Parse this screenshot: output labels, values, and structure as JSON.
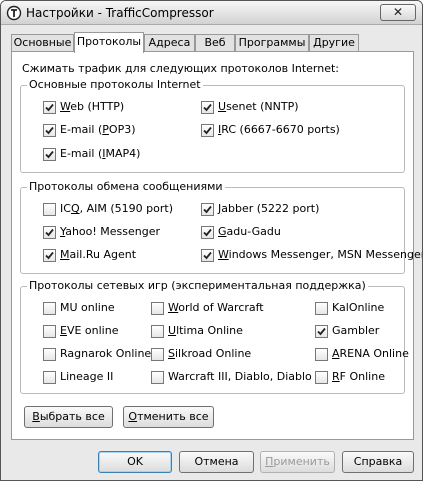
{
  "window": {
    "title": "Настройки - TrafficCompressor",
    "close_glyph": "✕"
  },
  "tabs": [
    {
      "label": "Основные",
      "active": false
    },
    {
      "label": "Протоколы",
      "active": true
    },
    {
      "label": "Адреса",
      "active": false
    },
    {
      "label": "Веб",
      "active": false
    },
    {
      "label": "Программы",
      "active": false
    },
    {
      "label": "Другие",
      "active": false
    }
  ],
  "intro": "Сжимать трафик для следующих протоколов Internet:",
  "groups": {
    "internet": {
      "title": "Основные протоколы Internet",
      "items": [
        {
          "pre": "",
          "u": "W",
          "post": "eb (HTTP)",
          "checked": true
        },
        {
          "pre": "",
          "u": "U",
          "post": "senet (NNTP)",
          "checked": true
        },
        {
          "pre": "E-mail (",
          "u": "P",
          "post": "OP3)",
          "checked": true
        },
        {
          "pre": "",
          "u": "I",
          "post": "RC (6667-6670 ports)",
          "checked": true
        },
        {
          "pre": "E-mail (",
          "u": "I",
          "post": "MAP4)",
          "checked": true
        }
      ]
    },
    "messaging": {
      "title": "Протоколы обмена сообщениями",
      "items": [
        {
          "pre": "IC",
          "u": "Q",
          "post": ", AIM (5190 port)",
          "checked": false
        },
        {
          "pre": "",
          "u": "J",
          "post": "abber (5222 port)",
          "checked": true
        },
        {
          "pre": "",
          "u": "Y",
          "post": "ahoo! Messenger",
          "checked": true
        },
        {
          "pre": "",
          "u": "G",
          "post": "adu-Gadu",
          "checked": true
        },
        {
          "pre": "",
          "u": "M",
          "post": "ail.Ru Agent",
          "checked": true
        },
        {
          "pre": "",
          "u": "W",
          "post": "indows Messenger, MSN Messenger",
          "checked": true
        }
      ]
    },
    "games": {
      "title": "Протоколы сетевых игр (экспериментальная поддержка)",
      "items": [
        {
          "pre": "MU online",
          "u": "",
          "post": "",
          "checked": false
        },
        {
          "pre": "",
          "u": "W",
          "post": "orld of Warcraft",
          "checked": false
        },
        {
          "pre": "KalOnline",
          "u": "",
          "post": "",
          "checked": false
        },
        {
          "pre": "",
          "u": "E",
          "post": "VE online",
          "checked": false
        },
        {
          "pre": "",
          "u": "U",
          "post": "ltima Online",
          "checked": false
        },
        {
          "pre": "Gambler",
          "u": "",
          "post": "",
          "checked": true
        },
        {
          "pre": "Ragnarok Online",
          "u": "",
          "post": "",
          "checked": false
        },
        {
          "pre": "",
          "u": "S",
          "post": "ilkroad Online",
          "checked": false
        },
        {
          "pre": "",
          "u": "A",
          "post": "RENA Online",
          "checked": false
        },
        {
          "pre": "Lineage II",
          "u": "",
          "post": "",
          "checked": false
        },
        {
          "pre": "Warcraft III, Diablo, Diablo II",
          "u": "",
          "post": "",
          "checked": false
        },
        {
          "pre": "",
          "u": "R",
          "post": "F Online",
          "checked": false
        }
      ]
    }
  },
  "actions": {
    "select_all": {
      "pre": "",
      "u": "В",
      "post": "ыбрать все"
    },
    "deselect_all": {
      "pre": "",
      "u": "О",
      "post": "тменить все"
    }
  },
  "footer": {
    "ok": "OK",
    "cancel": "Отмена",
    "apply": {
      "pre": "",
      "u": "П",
      "post": "рименить"
    },
    "help": "Справка"
  }
}
